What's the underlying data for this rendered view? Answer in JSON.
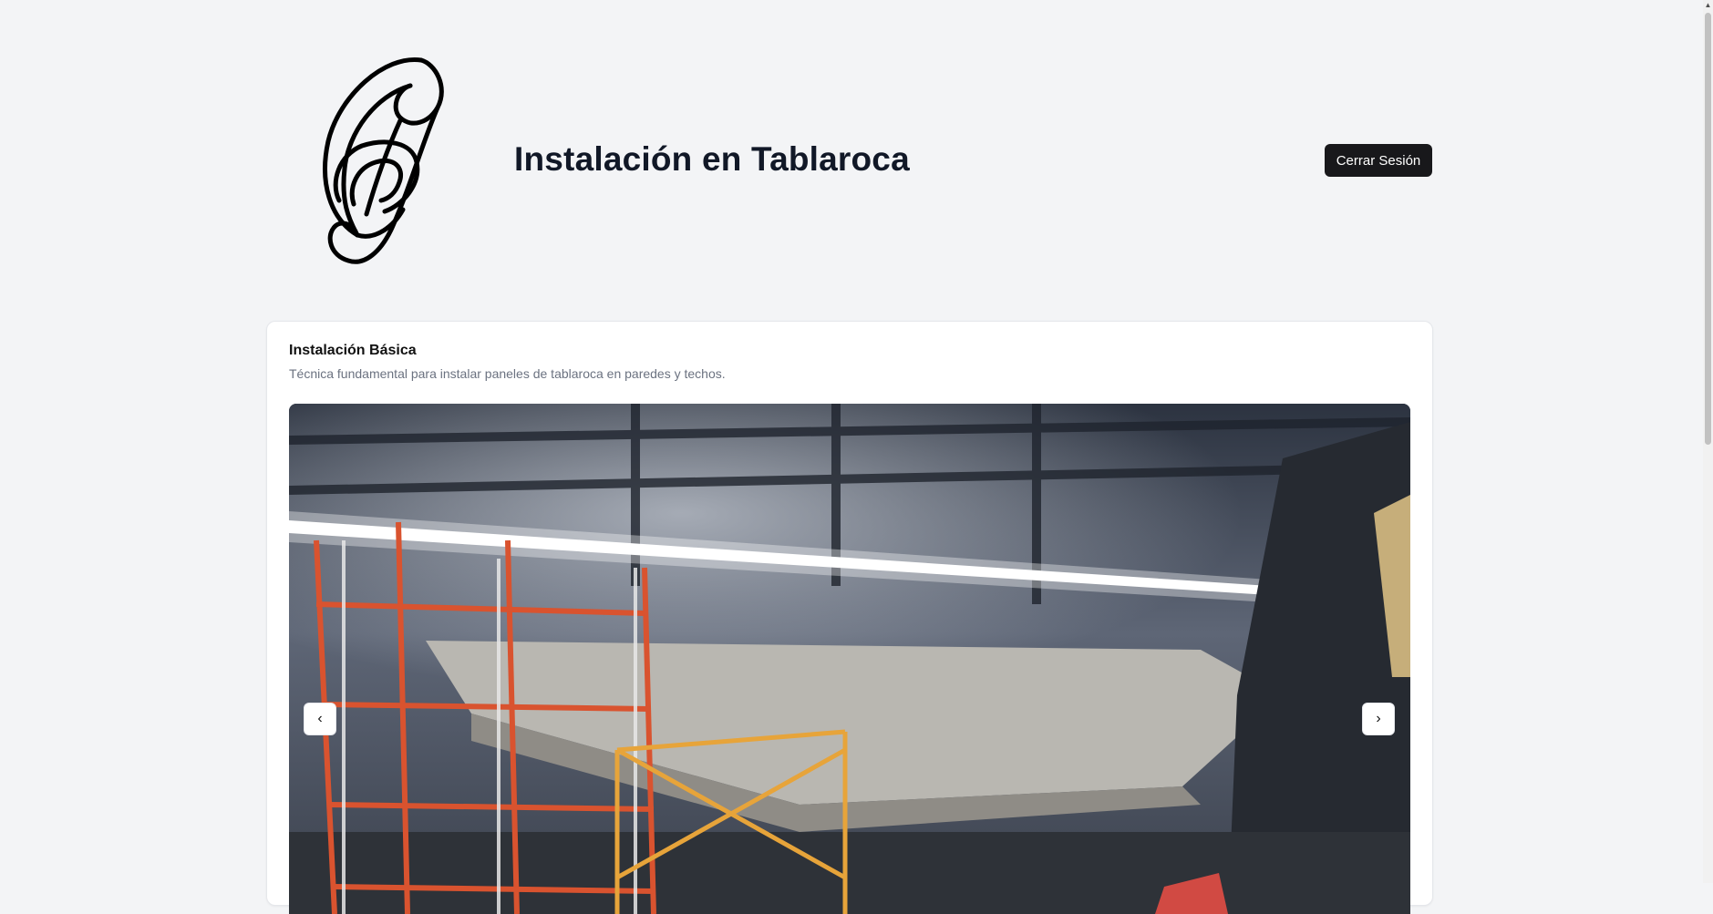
{
  "header": {
    "title": "Instalación en Tablaroca",
    "logout_label": "Cerrar Sesión",
    "logo_icon": "chain-link-logo-icon"
  },
  "card": {
    "title": "Instalación Básica",
    "description": "Técnica fundamental para instalar paneles de tablaroca en paredes y techos.",
    "carousel": {
      "prev_icon": "chevron-left-icon",
      "next_icon": "chevron-right-icon",
      "prev_symbol": "‹",
      "next_symbol": "›"
    }
  },
  "colors": {
    "background": "#f3f4f6",
    "button": "#18181b",
    "card": "#ffffff",
    "muted_text": "#6b7280"
  }
}
